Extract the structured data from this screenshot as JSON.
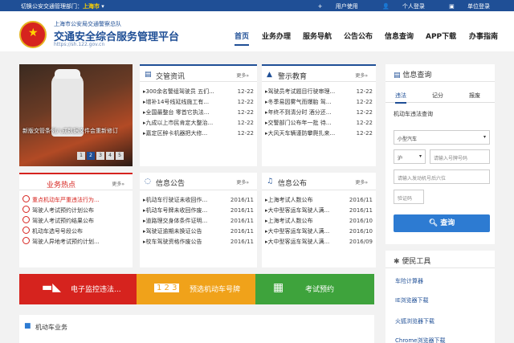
{
  "topbar": {
    "switch_label": "切换公安交通管理部门：",
    "city": "上海市",
    "user_link": "用户使用",
    "personal_login": "个人登录",
    "unit_login": "单位登录"
  },
  "header": {
    "subtitle": "上海市公安局交通警察总队",
    "title": "交通安全综合服务管理平台",
    "url": "https://sh.122.gov.cn"
  },
  "nav": [
    {
      "label": "首页",
      "active": true
    },
    {
      "label": "业务办理"
    },
    {
      "label": "服务导航"
    },
    {
      "label": "公告公布"
    },
    {
      "label": "信息查询"
    },
    {
      "label": "APP下载"
    },
    {
      "label": "办事指南"
    }
  ],
  "hero": {
    "caption": "新版交管条例八成数据文件会重新修订",
    "pages": [
      "1",
      "2",
      "3",
      "4",
      "5"
    ],
    "active_page": "2"
  },
  "news": {
    "title": "交管资讯",
    "more": "更多»",
    "items": [
      {
        "text": "300余名警组驾驶员 五们...",
        "date": "12-22"
      },
      {
        "text": "增补14号线延线施工有...",
        "date": "12-22"
      },
      {
        "text": "全国最整台 零首它执法...",
        "date": "12-22"
      },
      {
        "text": "九成以上市民肯定大整治...",
        "date": "12-22"
      },
      {
        "text": "嘉定区醉卡机器把大修...",
        "date": "12-22"
      }
    ]
  },
  "warning": {
    "title": "警示教育",
    "more": "更多»",
    "items": [
      {
        "text": "驾驶员考试题目行驶审理...",
        "date": "12-22"
      },
      {
        "text": "冬季易因雾气而爆胎 驾...",
        "date": "12-22"
      },
      {
        "text": "年终不到清分时 酒分还...",
        "date": "12-22"
      },
      {
        "text": "交警部门公布年一批 待...",
        "date": "12-22"
      },
      {
        "text": "大风天车辆谨防攀爬扎来...",
        "date": "12-22"
      }
    ]
  },
  "hot": {
    "title": "业务热点",
    "more": "更多»",
    "items": [
      {
        "text": "重点机动车严重违法行为...",
        "red": true
      },
      {
        "text": "驾驶人考试预约计划公布"
      },
      {
        "text": "驾驶人考试预约结果公布"
      },
      {
        "text": "机动车选号号段公布"
      },
      {
        "text": "驾驶人异地考试预约计划..."
      }
    ]
  },
  "notice": {
    "title": "信息公告",
    "more": "更多»",
    "items": [
      {
        "text": "机动车行驶证未收回作...",
        "date": "2016/11"
      },
      {
        "text": "机动车号牌未收回作废...",
        "date": "2016/11"
      },
      {
        "text": "道路理交身体条件证明...",
        "date": "2016/11"
      },
      {
        "text": "驾驶证逾期未换证公告",
        "date": "2016/11"
      },
      {
        "text": "校车驾驶资格作废公告",
        "date": "2016/11"
      }
    ]
  },
  "bulletin": {
    "title": "信息公布",
    "more": "更多»",
    "items": [
      {
        "text": "上海考试人数公布",
        "date": "2016/11"
      },
      {
        "text": "大中型客运车驾驶人满...",
        "date": "2016/11"
      },
      {
        "text": "上海考试人数公布",
        "date": "2016/10"
      },
      {
        "text": "大中型客运车驾驶人满...",
        "date": "2016/10"
      },
      {
        "text": "大中型客运车驾驶人满...",
        "date": "2016/09"
      }
    ]
  },
  "query": {
    "title": "信息查询",
    "tabs": [
      "违法",
      "记分",
      "报废"
    ],
    "active_tab": "违法",
    "label": "机动车违法查询",
    "vehicle_type": "小型汽车",
    "province": "沪",
    "plate_placeholder": "请输入号牌号码",
    "engine_placeholder": "请输入发动机号后六位",
    "captcha_placeholder": "验证码",
    "submit": "查询"
  },
  "tools": {
    "title": "便民工具",
    "items": [
      "车险计算器",
      "IE浏览器下载",
      "火狐浏览器下载",
      "Chrome浏览器下载"
    ]
  },
  "banners": [
    {
      "label": "电子监控违法...",
      "color": "#d6231e",
      "icon": "camera-icon"
    },
    {
      "label": "预选机动车号牌",
      "color": "#f0a21a",
      "icon": "plate-icon"
    },
    {
      "label": "考试预约",
      "color": "#3ea33c",
      "icon": "calendar-icon"
    }
  ],
  "vehicle_section": {
    "title": "机动车业务"
  }
}
